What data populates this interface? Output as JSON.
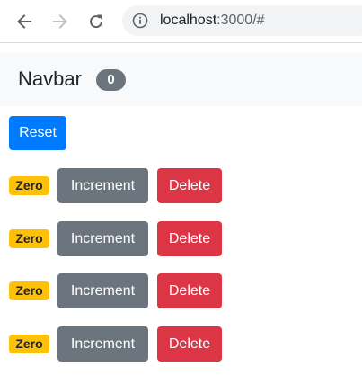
{
  "browser": {
    "url_host": "localhost",
    "url_rest": ":3000/#"
  },
  "navbar": {
    "brand": "Navbar",
    "total_count": "0"
  },
  "reset_label": "Reset",
  "counters": [
    {
      "badge": "Zero",
      "increment_label": "Increment",
      "delete_label": "Delete"
    },
    {
      "badge": "Zero",
      "increment_label": "Increment",
      "delete_label": "Delete"
    },
    {
      "badge": "Zero",
      "increment_label": "Increment",
      "delete_label": "Delete"
    },
    {
      "badge": "Zero",
      "increment_label": "Increment",
      "delete_label": "Delete"
    }
  ],
  "colors": {
    "primary": "#007bff",
    "secondary": "#6c757d",
    "danger": "#dc3545",
    "warning": "#ffc107",
    "navbar_bg": "#f8f9fa"
  },
  "icons": {
    "back": "arrow-left-icon",
    "forward": "arrow-right-icon",
    "reload": "reload-icon",
    "site_info": "info-icon"
  }
}
